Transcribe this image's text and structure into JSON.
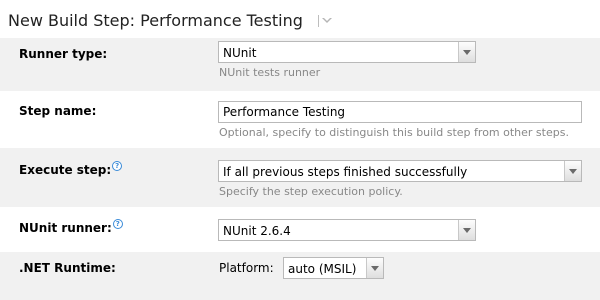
{
  "header": {
    "title": "New Build Step: Performance Testing",
    "menu_icon": "dropdown-triangle"
  },
  "fields": {
    "runner_type": {
      "label": "Runner type:",
      "value": "NUnit",
      "hint": "NUnit tests runner"
    },
    "step_name": {
      "label": "Step name:",
      "value": "Performance Testing",
      "hint": "Optional, specify to distinguish this build step from other steps."
    },
    "execute_step": {
      "label": "Execute step:",
      "value": "If all previous steps finished successfully",
      "hint": "Specify the step execution policy."
    },
    "nunit_runner": {
      "label": "NUnit runner:",
      "value": "NUnit 2.6.4"
    },
    "net_runtime": {
      "label": ".NET Runtime:",
      "platform_label": "Platform:",
      "platform_value": "auto (MSIL)"
    }
  },
  "colors": {
    "shaded_row": "#f1f1f1",
    "help_icon": "#3a8bd8",
    "hint_text": "#888888"
  }
}
